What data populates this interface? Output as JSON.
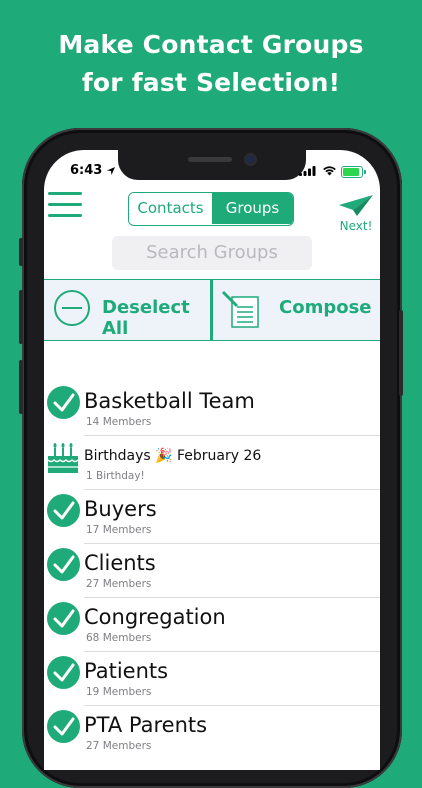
{
  "headline": {
    "line1": "Make Contact Groups",
    "line2": "for fast Selection!"
  },
  "status_bar": {
    "time": "6:43"
  },
  "nav": {
    "tabs": [
      {
        "label": "Contacts",
        "active": false
      },
      {
        "label": "Groups",
        "active": true
      }
    ],
    "next_label": "Next!",
    "search_placeholder": "Search Groups"
  },
  "actions": {
    "deselect_label": "Deselect All",
    "compose_label": "Compose"
  },
  "colors": {
    "accent": "#1faa7a",
    "background": "#1faa7a",
    "action_bar_bg": "#eef3fa"
  },
  "groups": [
    {
      "name": "Basketball Team",
      "subtitle": "14 Members",
      "icon": "check-circle-icon"
    },
    {
      "name": "Birthdays 🎉 February 26",
      "subtitle": "1 Birthday!",
      "icon": "birthday-cake-icon"
    },
    {
      "name": "Buyers",
      "subtitle": "17 Members",
      "icon": "check-circle-icon"
    },
    {
      "name": "Clients",
      "subtitle": "27 Members",
      "icon": "check-circle-icon"
    },
    {
      "name": "Congregation",
      "subtitle": "68 Members",
      "icon": "check-circle-icon"
    },
    {
      "name": "Patients",
      "subtitle": "19 Members",
      "icon": "check-circle-icon"
    },
    {
      "name": "PTA Parents",
      "subtitle": "27 Members",
      "icon": "check-circle-icon"
    }
  ]
}
